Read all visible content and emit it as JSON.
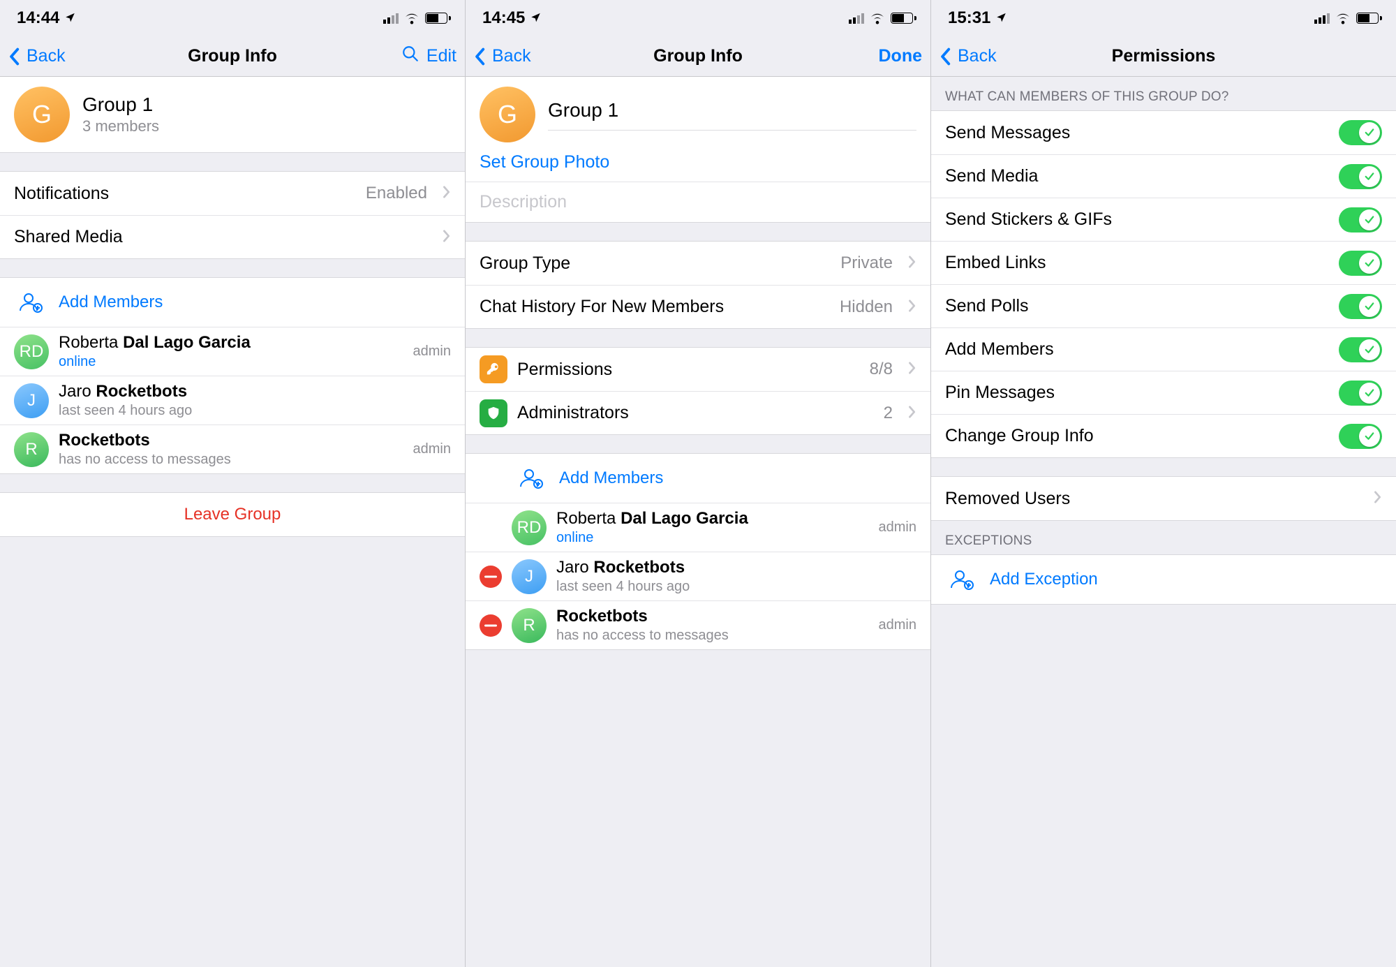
{
  "screens": [
    {
      "status_time": "14:44",
      "nav": {
        "back": "Back",
        "title": "Group Info",
        "edit": "Edit"
      },
      "group": {
        "name": "Group 1",
        "subtitle": "3 members",
        "initial": "G"
      },
      "rows": {
        "notifications": {
          "label": "Notifications",
          "value": "Enabled"
        },
        "shared_media": {
          "label": "Shared Media"
        },
        "add_members": {
          "label": "Add Members"
        }
      },
      "members": [
        {
          "initials": "RD",
          "name_first": "Roberta ",
          "name_bold": "Dal Lago Garcia",
          "sub": "online",
          "online": true,
          "role": "admin",
          "avatar": "green"
        },
        {
          "initials": "J",
          "name_first": "Jaro ",
          "name_bold": "Rocketbots",
          "sub": "last seen 4 hours ago",
          "online": false,
          "role": "",
          "avatar": "blue"
        },
        {
          "initials": "R",
          "name_first": "",
          "name_bold": "Rocketbots",
          "sub": "has no access to messages",
          "online": false,
          "role": "admin",
          "avatar": "green2"
        }
      ],
      "leave": "Leave Group"
    },
    {
      "status_time": "14:45",
      "nav": {
        "back": "Back",
        "title": "Group Info",
        "done": "Done"
      },
      "group": {
        "name": "Group 1",
        "initial": "G"
      },
      "rows": {
        "set_photo": "Set Group Photo",
        "description_placeholder": "Description",
        "group_type": {
          "label": "Group Type",
          "value": "Private"
        },
        "history": {
          "label": "Chat History For New Members",
          "value": "Hidden"
        },
        "permissions": {
          "label": "Permissions",
          "value": "8/8"
        },
        "admins": {
          "label": "Administrators",
          "value": "2"
        },
        "add_members": {
          "label": "Add Members"
        }
      },
      "members": [
        {
          "initials": "RD",
          "name_first": "Roberta ",
          "name_bold": "Dal Lago Garcia",
          "sub": "online",
          "online": true,
          "role": "admin",
          "avatar": "green"
        },
        {
          "initials": "J",
          "name_first": "Jaro ",
          "name_bold": "Rocketbots",
          "sub": "last seen 4 hours ago",
          "online": false,
          "role": "",
          "avatar": "blue"
        },
        {
          "initials": "R",
          "name_first": "",
          "name_bold": "Rocketbots",
          "sub": "has no access to messages",
          "online": false,
          "role": "admin",
          "avatar": "green2"
        }
      ]
    },
    {
      "status_time": "15:31",
      "nav": {
        "back": "Back",
        "title": "Permissions"
      },
      "section1_header": "What can members of this group do?",
      "permissions": [
        {
          "label": "Send Messages",
          "on": true
        },
        {
          "label": "Send Media",
          "on": true
        },
        {
          "label": "Send Stickers & GIFs",
          "on": true
        },
        {
          "label": "Embed Links",
          "on": true
        },
        {
          "label": "Send Polls",
          "on": true
        },
        {
          "label": "Add Members",
          "on": true
        },
        {
          "label": "Pin Messages",
          "on": true
        },
        {
          "label": "Change Group Info",
          "on": true
        }
      ],
      "removed_users": "Removed Users",
      "exceptions_header": "Exceptions",
      "add_exception": "Add Exception"
    }
  ]
}
